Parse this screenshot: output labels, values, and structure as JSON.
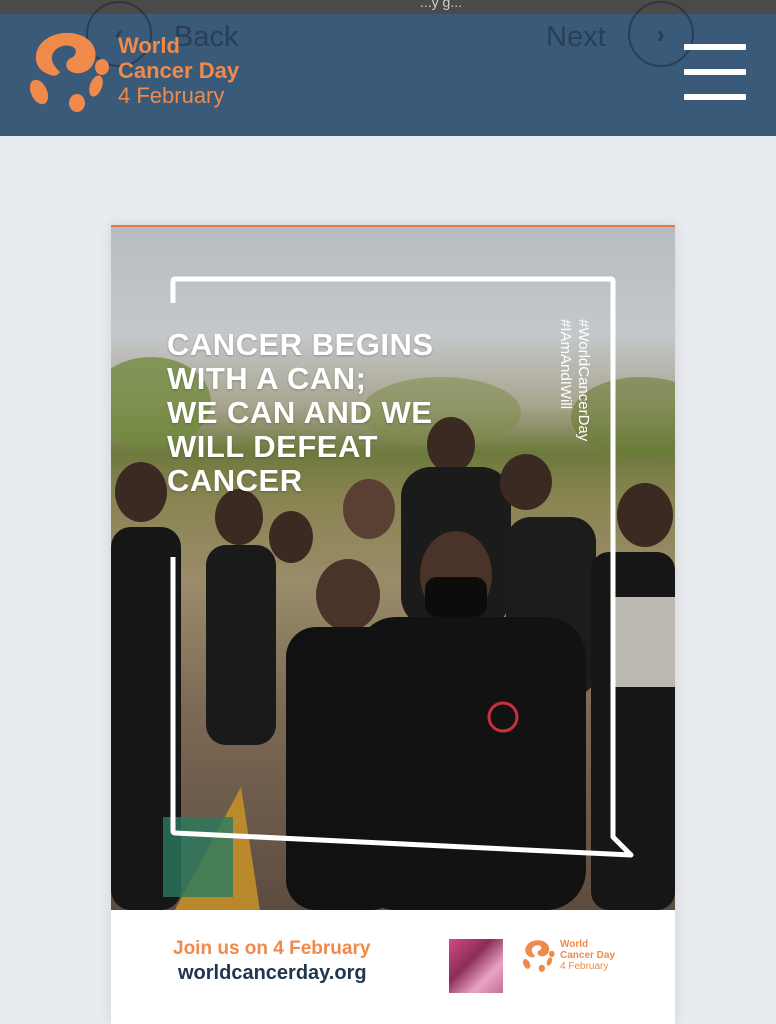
{
  "status_bar": {
    "text": "...y g..."
  },
  "nav": {
    "back_label": "Back",
    "next_label": "Next"
  },
  "logo": {
    "line1": "World",
    "line2": "Cancer Day",
    "line3": "4 February"
  },
  "poster": {
    "headline": "CANCER BEGINS\nWITH A CAN;\nWE CAN AND WE\nWILL DEFEAT\nCANCER",
    "hashtags": [
      "#WorldCancerDay",
      "#IAmAndIWill"
    ],
    "join_text": "Join us on 4 February",
    "url": "worldcancerday.org",
    "mini_logo": {
      "line1": "World",
      "line2": "Cancer Day",
      "line3": "4 February"
    }
  },
  "colors": {
    "header_bg": "#3a5a7a",
    "brand_orange": "#f08a4b",
    "brand_navy": "#1f3550",
    "page_bg": "#e8ebef"
  },
  "icons": [
    "back-chevron-icon",
    "next-chevron-icon",
    "hamburger-menu-icon",
    "world-cancer-day-logo-icon"
  ]
}
